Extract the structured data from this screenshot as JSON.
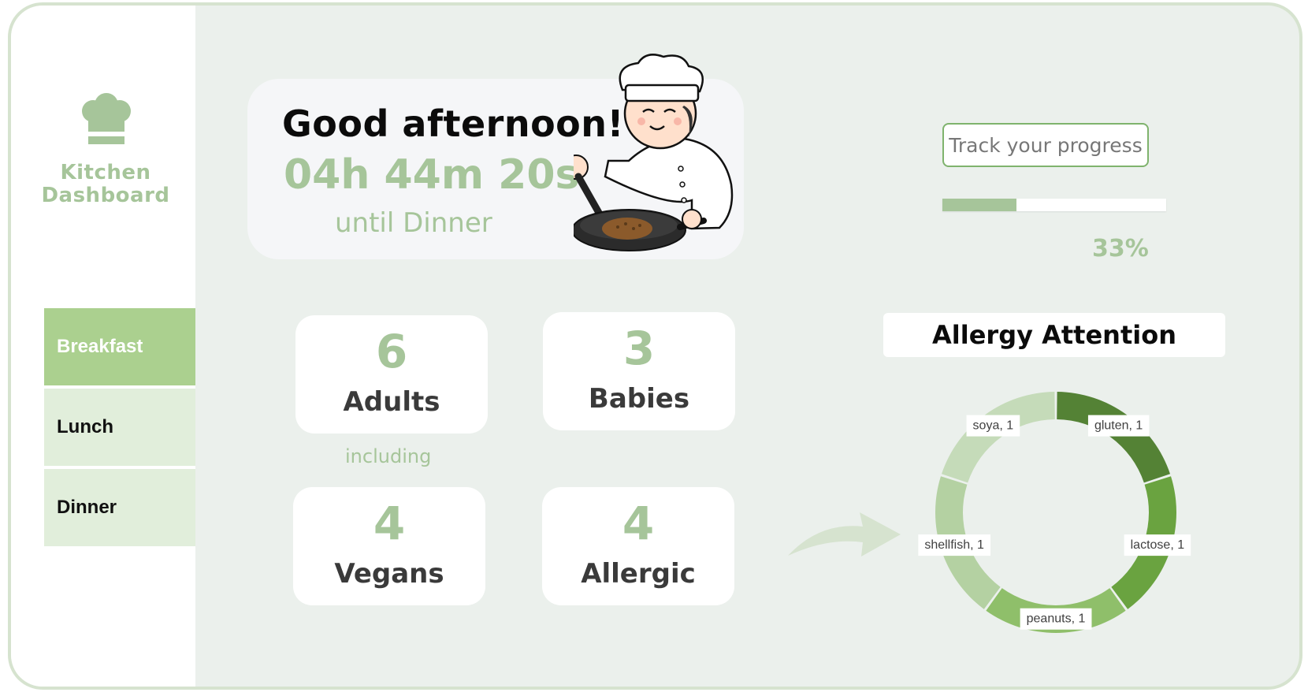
{
  "sidebar": {
    "logo_icon": "chef-hat-icon",
    "title": "Kitchen\nDashboard",
    "meals": [
      {
        "label": "Breakfast",
        "active": true
      },
      {
        "label": "Lunch",
        "active": false
      },
      {
        "label": "Dinner",
        "active": false
      }
    ]
  },
  "greeting": {
    "title": "Good afternoon!",
    "countdown": "04h 44m 20s",
    "subtitle": "until Dinner",
    "illustration": "chef-cooking-illustration"
  },
  "stats": {
    "adults": {
      "value": "6",
      "label": "Adults"
    },
    "babies": {
      "value": "3",
      "label": "Babies"
    },
    "including": "including",
    "vegans": {
      "value": "4",
      "label": "Vegans"
    },
    "allergic": {
      "value": "4",
      "label": "Allergic"
    }
  },
  "progress": {
    "button_label": "Track your progress",
    "value": 0.33,
    "percent_text": "33%"
  },
  "allergy": {
    "title": "Allergy Attention"
  },
  "colors": {
    "accent": "#a6c59a",
    "nav_active": "#abd08f",
    "nav_inactive": "#e1eedb",
    "background": "#ebf0ec"
  },
  "chart_data": {
    "type": "pie",
    "categories": [
      "gluten",
      "lactose",
      "peanuts",
      "shellfish",
      "soya"
    ],
    "values": [
      1,
      1,
      1,
      1,
      1
    ],
    "labels": [
      "gluten, 1",
      "lactose, 1",
      "peanuts, 1",
      "shellfish, 1",
      "soya, 1"
    ],
    "colors": [
      "#548235",
      "#6aa340",
      "#8fbf6a",
      "#b4d1a2",
      "#c5dbb9"
    ],
    "donut": true
  }
}
